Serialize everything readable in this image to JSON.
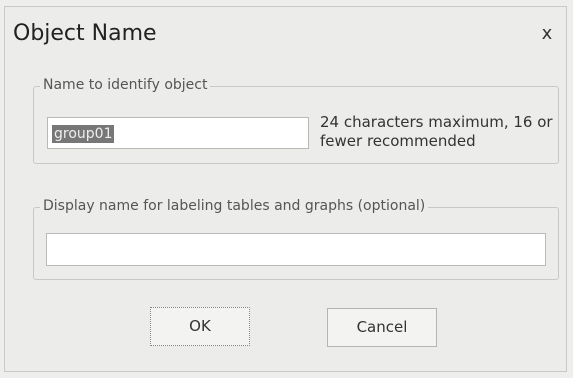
{
  "window": {
    "title": "Object Name",
    "close_glyph": "x"
  },
  "name_group": {
    "label": "Name to identify object",
    "value": "group01",
    "hint": "24 characters maximum, 16 or fewer recommended"
  },
  "display_group": {
    "label": "Display name for labeling tables and graphs  (optional)",
    "value": ""
  },
  "buttons": {
    "ok_label": "OK",
    "cancel_label": "Cancel"
  },
  "colors": {
    "dialog_background": "#ececeb",
    "selection_highlight": "#777777"
  }
}
